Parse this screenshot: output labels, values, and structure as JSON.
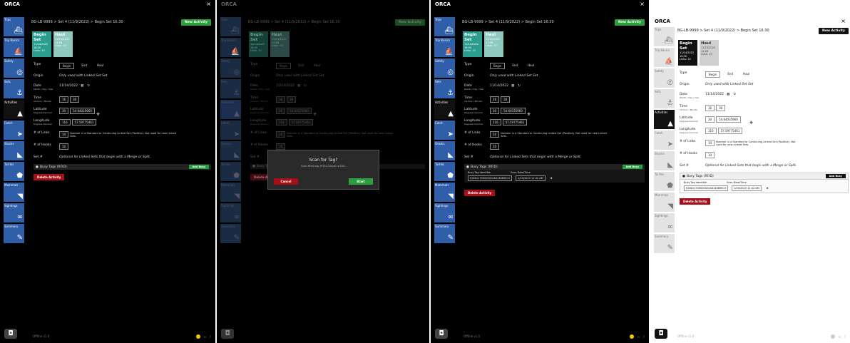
{
  "app": {
    "title": "ORCA",
    "close_glyph": "×"
  },
  "breadcrumb": "BG-LB-9999  >  Set 4 (11/9/2022)  >  Begin Set 16:30",
  "new_activity_label": "New Activity",
  "cards": [
    {
      "title": "Begin Set",
      "lines": [
        "11/14/2022",
        "16:30",
        "Links: 10"
      ]
    },
    {
      "title": "Haul",
      "lines": [
        "11/15/2022",
        "11:08",
        "Links: 10"
      ]
    }
  ],
  "sidebar": [
    {
      "label": "Trips",
      "icon": "ship-icon",
      "glyph": "⛴"
    },
    {
      "label": "Trip Basics",
      "icon": "boat-icon",
      "glyph": "⛵"
    },
    {
      "label": "Safety",
      "icon": "life-ring-icon",
      "glyph": "◎"
    },
    {
      "label": "Sets",
      "icon": "hook-icon",
      "glyph": "⚓"
    },
    {
      "label": "Activities",
      "icon": "buoy-icon",
      "glyph": "▲"
    },
    {
      "label": "Catch",
      "icon": "fish-icon",
      "glyph": "➤"
    },
    {
      "label": "Sharks",
      "icon": "shark-icon",
      "glyph": "◣"
    },
    {
      "label": "Turtles",
      "icon": "turtle-icon",
      "glyph": "⬟"
    },
    {
      "label": "Mammals",
      "icon": "whale-icon",
      "glyph": "◥"
    },
    {
      "label": "Sightings",
      "icon": "binoculars-icon",
      "glyph": "∞"
    },
    {
      "label": "Summary",
      "icon": "summary-icon",
      "glyph": "✎"
    }
  ],
  "form": {
    "type_label": "Type",
    "type_options": [
      "Begin",
      "End",
      "Haul"
    ],
    "origin_label": "Origin",
    "origin_value": "Only used with Linked Set Set",
    "date_label": "Date",
    "date_sub": "Month / Day / Year",
    "date_value": "11/14/2022",
    "time_label": "Time",
    "time_sub": "24-hour / Minute",
    "time_h": "16",
    "time_m": "30",
    "lat_label": "Latitude",
    "lat_sub": "Degrees Decimal",
    "lat_deg": "30",
    "lat_min": "54.64035960",
    "lon_label": "Longitude",
    "lon_sub": "Degrees Decimal",
    "lon_deg": "116",
    "lon_min": "57.59775461",
    "links_label": "# of Links",
    "links_value": "10",
    "links_note": "Number in a Standard or Continuing Linked Set (Positive). Not used for new Linked Sets.",
    "hooks_label": "# of Hooks",
    "hooks_value": "10",
    "set_label": "Set #",
    "set_note": "Optional for Linked Sets that begin with a Merge or Split."
  },
  "busy": {
    "title": "Busy Tags (RFID)",
    "add_label": "Add Busy",
    "col1": "Busy Tag Identifier",
    "col2": "Scan Date/Time",
    "tag_id": "E28011700000020A814685EC3",
    "tag_time": "1/20/2023 11:42 AM",
    "remove_glyph": "✖"
  },
  "delete_label": "Delete Activity",
  "modal": {
    "title": "Scan for Tag?",
    "message": "Scan RFID tag. Press Cancel to Exit.",
    "cancel": "Cancel",
    "start": "Start"
  },
  "footer": {
    "version": "Offline v1.0",
    "status": "ORCA"
  },
  "colors": {
    "dark_bg": "#000000",
    "dark_panel": "#1b1b1b",
    "teal": "#2a9d8f",
    "green": "#2e9f3f",
    "red": "#a50f1a",
    "sidebar_dark": "#2f5fa8",
    "sidebar_light": "#d8d8d8",
    "light_bg": "#ffffff"
  }
}
